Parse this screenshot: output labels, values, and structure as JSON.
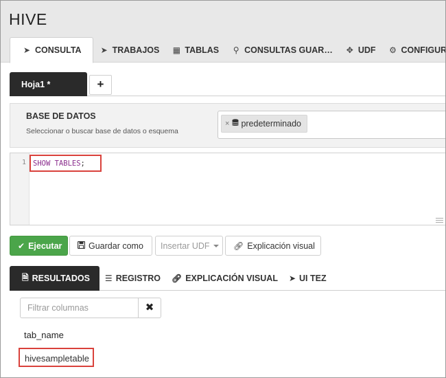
{
  "app": {
    "title": "HIVE"
  },
  "nav_tabs": [
    {
      "label": "CONSULTA",
      "icon": "paper-plane-icon",
      "active": true
    },
    {
      "label": "TRABAJOS",
      "icon": "paper-plane-icon"
    },
    {
      "label": "TABLAS",
      "icon": "table-icon"
    },
    {
      "label": "CONSULTAS GUAR…",
      "icon": "paperclip-icon"
    },
    {
      "label": "UDF",
      "icon": "puzzle-icon"
    },
    {
      "label": "CONFIGURACIÓN",
      "icon": "gear-icon"
    }
  ],
  "worksheet": {
    "tab_label": "Hoja1 *",
    "add_label": "+"
  },
  "database": {
    "title": "BASE DE DATOS",
    "subtitle": "Seleccionar o buscar base de datos o esquema",
    "token_remove": "×",
    "selected": "predeterminado"
  },
  "editor": {
    "line_number": "1",
    "code_keyword": "SHOW TABLES",
    "code_terminator": ";"
  },
  "actions": {
    "run": "Ejecutar",
    "save_as": "Guardar como",
    "insert_udf": "Insertar UDF",
    "visual_explain": "Explicación visual"
  },
  "result_tabs": [
    {
      "label": "RESULTADOS",
      "icon": "file-icon",
      "active": true
    },
    {
      "label": "REGISTRO",
      "icon": "list-icon"
    },
    {
      "label": "EXPLICACIÓN VISUAL",
      "icon": "link-icon"
    },
    {
      "label": "UI TEZ",
      "icon": "paper-plane-icon"
    }
  ],
  "results": {
    "filter_placeholder": "Filtrar columnas",
    "clear_label": "✖",
    "columns": [
      "tab_name"
    ],
    "rows": [
      [
        "hivesampletable"
      ]
    ]
  },
  "colors": {
    "run_button": "#4ba54a",
    "highlight": "#d9413b",
    "keyword": "#8b2e8e",
    "dark_tab": "#2a2a2a"
  }
}
